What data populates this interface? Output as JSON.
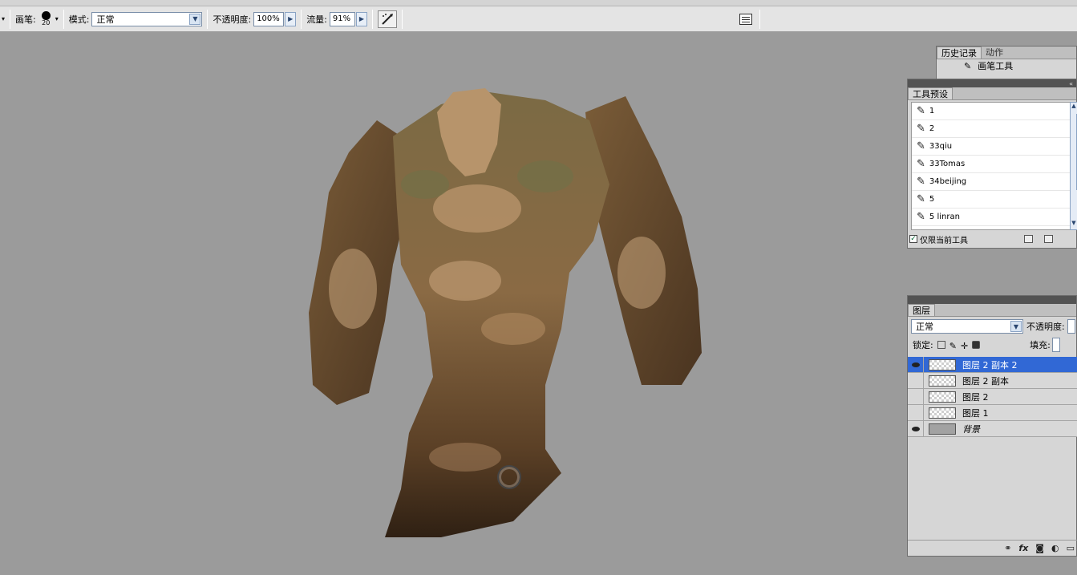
{
  "options_bar": {
    "brush_label": "画笔:",
    "brush_size": "20",
    "mode_label": "模式:",
    "mode_value": "正常",
    "opacity_label": "不透明度:",
    "opacity_value": "100%",
    "flow_label": "流量:",
    "flow_value": "91%"
  },
  "history_panel": {
    "tabs": [
      "历史记录",
      "动作"
    ],
    "row_label": "画笔工具"
  },
  "presets_panel": {
    "title": "工具预设",
    "items": [
      "1",
      "2",
      "33qiu",
      "33Tomas",
      "34beijing",
      "5",
      "5 linran"
    ],
    "current_only_label": "仅限当前工具"
  },
  "layers_panel": {
    "title": "图层",
    "blend_mode": "正常",
    "opacity_label": "不透明度:",
    "lock_label": "锁定:",
    "fill_label": "填充:",
    "layers": [
      {
        "name": "图层 2 副本 2",
        "visible": true,
        "selected": true
      },
      {
        "name": "图层 2 副本",
        "visible": false,
        "selected": false
      },
      {
        "name": "图层 2",
        "visible": false,
        "selected": false
      },
      {
        "name": "图层 1",
        "visible": false,
        "selected": false
      },
      {
        "name": "背景",
        "visible": true,
        "selected": false
      }
    ],
    "footer_icons": [
      "link-icon",
      "fx-icon",
      "mask-icon",
      "adjustment-icon",
      "folder-icon"
    ]
  },
  "colors": {
    "canvas_bg": "#9b9b9b",
    "selection": "#3168d5",
    "panel": "#d6d6d6"
  }
}
